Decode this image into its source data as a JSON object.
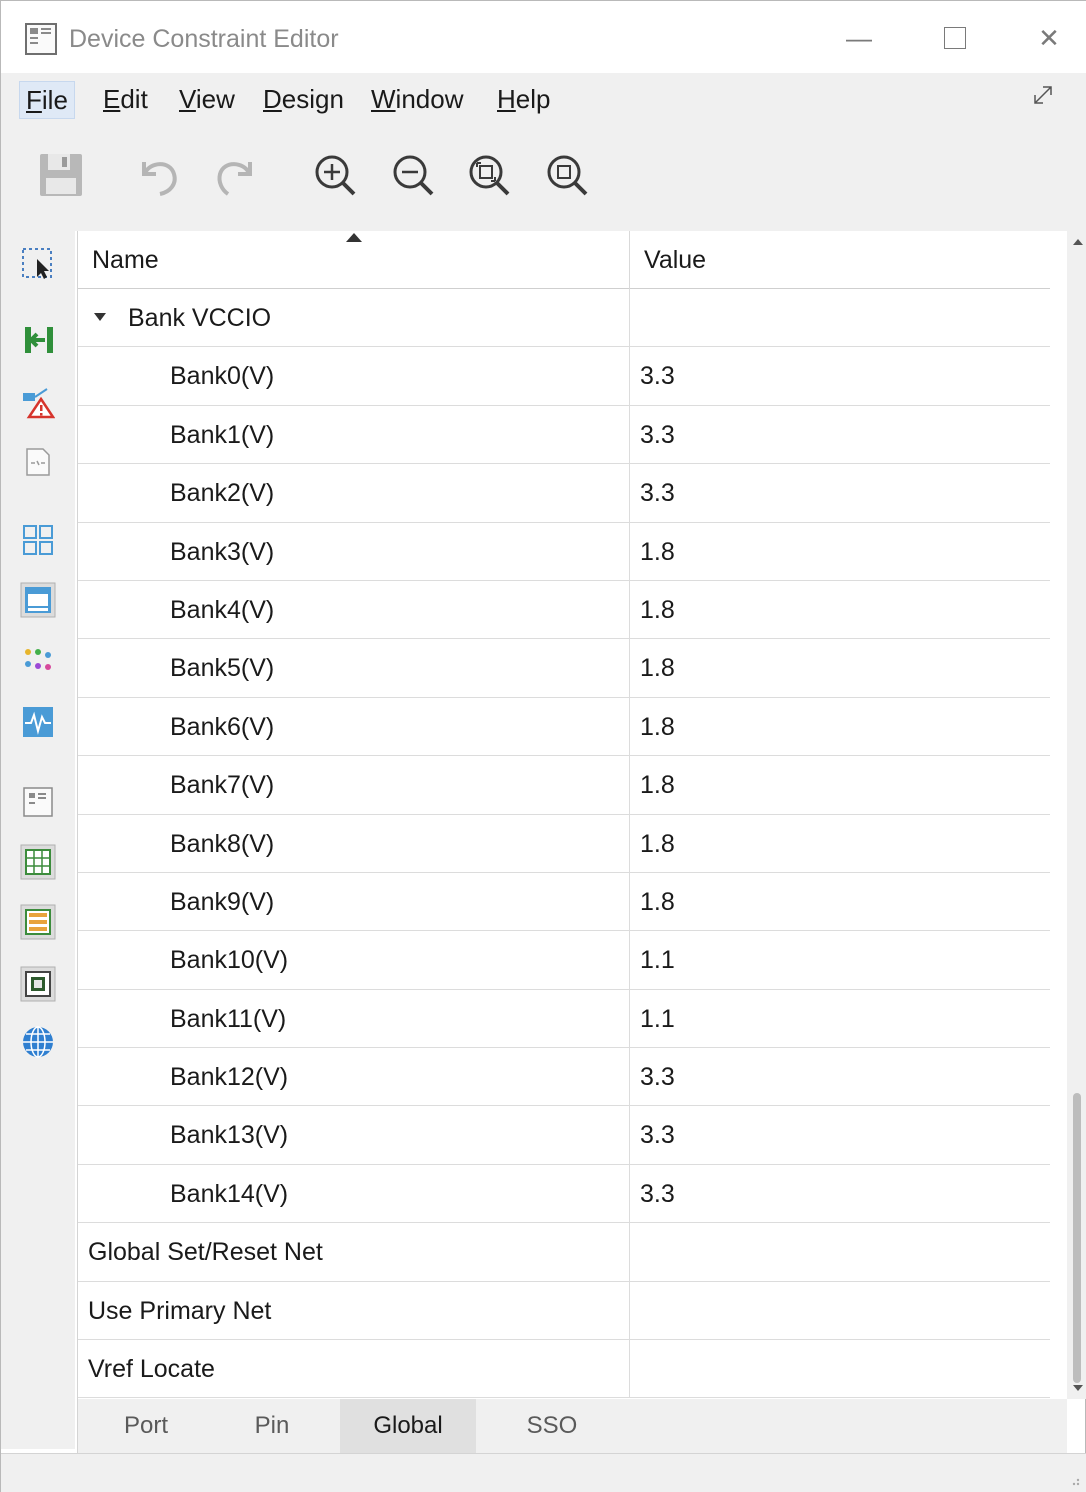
{
  "window": {
    "title": "Device Constraint Editor",
    "minimize_label": "—",
    "close_label": "✕"
  },
  "menu": {
    "items": [
      {
        "label": "File",
        "mnemonic": "F",
        "rest": "ile"
      },
      {
        "label": "Edit",
        "mnemonic": "E",
        "rest": "dit"
      },
      {
        "label": "View",
        "mnemonic": "V",
        "rest": "iew"
      },
      {
        "label": "Design",
        "mnemonic": "D",
        "rest": "esign"
      },
      {
        "label": "Window",
        "mnemonic": "W",
        "rest": "indow"
      },
      {
        "label": "Help",
        "mnemonic": "H",
        "rest": "elp"
      }
    ]
  },
  "toolbar": {
    "buttons": [
      "save-icon",
      "undo-icon",
      "redo-icon",
      "zoom-in-icon",
      "zoom-out-icon",
      "zoom-fit-icon",
      "zoom-selection-icon"
    ]
  },
  "sidebar": {
    "buttons": [
      "select-tool-icon",
      "port-assign-icon",
      "warning-flow-icon",
      "pin-map-icon",
      "grid-view-icon",
      "device-view-icon",
      "color-dots-icon",
      "waveform-icon",
      "package-view-icon",
      "table-view-icon",
      "list-view-icon",
      "chip-view-icon",
      "globe-icon"
    ]
  },
  "table": {
    "columns": {
      "name": "Name",
      "value": "Value"
    },
    "rows": [
      {
        "name": "Bank VCCIO",
        "value": "",
        "type": "group"
      },
      {
        "name": "Bank0(V)",
        "value": "3.3",
        "type": "child"
      },
      {
        "name": "Bank1(V)",
        "value": "3.3",
        "type": "child"
      },
      {
        "name": "Bank2(V)",
        "value": "3.3",
        "type": "child"
      },
      {
        "name": "Bank3(V)",
        "value": "1.8",
        "type": "child"
      },
      {
        "name": "Bank4(V)",
        "value": "1.8",
        "type": "child"
      },
      {
        "name": "Bank5(V)",
        "value": "1.8",
        "type": "child"
      },
      {
        "name": "Bank6(V)",
        "value": "1.8",
        "type": "child"
      },
      {
        "name": "Bank7(V)",
        "value": "1.8",
        "type": "child"
      },
      {
        "name": "Bank8(V)",
        "value": "1.8",
        "type": "child"
      },
      {
        "name": "Bank9(V)",
        "value": "1.8",
        "type": "child"
      },
      {
        "name": "Bank10(V)",
        "value": "1.1",
        "type": "child"
      },
      {
        "name": "Bank11(V)",
        "value": "1.1",
        "type": "child"
      },
      {
        "name": "Bank12(V)",
        "value": "3.3",
        "type": "child"
      },
      {
        "name": "Bank13(V)",
        "value": "3.3",
        "type": "child"
      },
      {
        "name": "Bank14(V)",
        "value": "3.3",
        "type": "child"
      },
      {
        "name": "Global Set/Reset Net",
        "value": "",
        "type": "top"
      },
      {
        "name": "Use Primary Net",
        "value": "",
        "type": "top"
      },
      {
        "name": "Vref Locate",
        "value": "",
        "type": "top"
      }
    ]
  },
  "tabs": {
    "items": [
      "Port",
      "Pin",
      "Global",
      "SSO"
    ],
    "active": "Global"
  }
}
